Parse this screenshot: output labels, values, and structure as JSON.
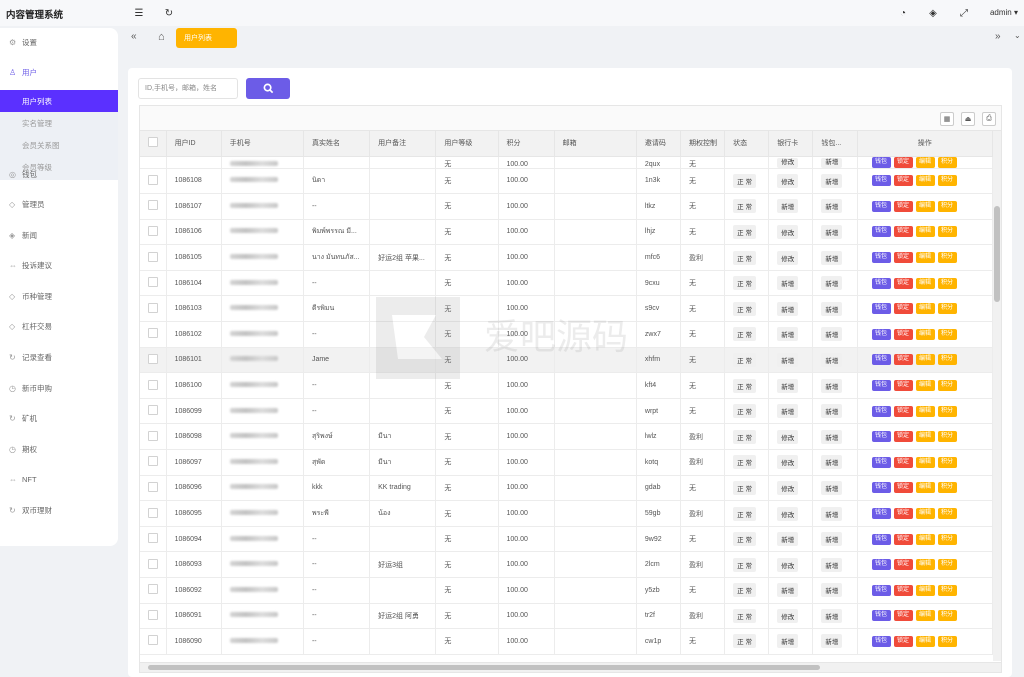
{
  "app": {
    "title": "内容管理系统",
    "user": "admin ▾"
  },
  "sidebar": {
    "items": [
      {
        "label": "设置",
        "icon": "gear-icon",
        "glyph": "⚙"
      },
      {
        "label": "用户",
        "icon": "user-icon",
        "glyph": "♙"
      },
      {
        "label": "钱包",
        "icon": "wallet-icon",
        "glyph": "◎"
      },
      {
        "label": "管理员",
        "icon": "shield-icon",
        "glyph": "◇"
      },
      {
        "label": "新闻",
        "icon": "tag-icon",
        "glyph": "◈"
      },
      {
        "label": "投诉建议",
        "icon": "link-icon",
        "glyph": "⇔"
      },
      {
        "label": "币种管理",
        "icon": "diamond-icon",
        "glyph": "◇"
      },
      {
        "label": "杠杆交易",
        "icon": "diamond-icon",
        "glyph": "◇"
      },
      {
        "label": "记录查看",
        "icon": "refresh-icon",
        "glyph": "↻"
      },
      {
        "label": "新币申购",
        "icon": "clock-icon",
        "glyph": "◷"
      },
      {
        "label": "矿机",
        "icon": "refresh-icon",
        "glyph": "↻"
      },
      {
        "label": "期权",
        "icon": "clock-icon",
        "glyph": "◷"
      },
      {
        "label": "NFT",
        "icon": "link-icon",
        "glyph": "⇔"
      },
      {
        "label": "双币理财",
        "icon": "refresh-icon",
        "glyph": "↻"
      }
    ],
    "submenu": [
      "用户列表",
      "实名管理",
      "会员关系图",
      "会员等级"
    ]
  },
  "tabs": {
    "active": "用户列表"
  },
  "search": {
    "placeholder": "ID,手机号，邮箱，姓名"
  },
  "table": {
    "columns": [
      "用户ID",
      "手机号",
      "真实姓名",
      "用户备注",
      "用户等级",
      "积分",
      "邮箱",
      "邀请码",
      "期权控制",
      "状态",
      "银行卡",
      "钱包...",
      "操作"
    ],
    "actions": [
      "钱包",
      "锁定",
      "编辑",
      "积分"
    ],
    "partial_row": {
      "level": "无",
      "points": "100.00",
      "code": "2qux",
      "ctrl": "无",
      "bank": "修改",
      "wallet": "新增"
    },
    "rows": [
      {
        "id": "1086108",
        "name": "นิดา",
        "note": "",
        "level": "无",
        "points": "100.00",
        "code": "1n3k",
        "ctrl": "无",
        "status": "正 常",
        "bank": "修改",
        "wallet": "新增"
      },
      {
        "id": "1086107",
        "name": "--",
        "note": "",
        "level": "无",
        "points": "100.00",
        "code": "ltkz",
        "ctrl": "无",
        "status": "正 常",
        "bank": "新增",
        "wallet": "新增"
      },
      {
        "id": "1086106",
        "name": "พิมพ์พรรณ มี...",
        "note": "",
        "level": "无",
        "points": "100.00",
        "code": "lhjz",
        "ctrl": "无",
        "status": "正 常",
        "bank": "修改",
        "wallet": "新增"
      },
      {
        "id": "1086105",
        "name": "นาง มันทนภัส...",
        "note": "好运2组 苹果...",
        "level": "无",
        "points": "100.00",
        "code": "mfc6",
        "ctrl": "盈利",
        "status": "正 常",
        "bank": "修改",
        "wallet": "新增"
      },
      {
        "id": "1086104",
        "name": "--",
        "note": "",
        "level": "无",
        "points": "100.00",
        "code": "9cxu",
        "ctrl": "无",
        "status": "正 常",
        "bank": "新增",
        "wallet": "新增"
      },
      {
        "id": "1086103",
        "name": "ดีรพิมน",
        "note": "",
        "level": "无",
        "points": "100.00",
        "code": "s9cv",
        "ctrl": "无",
        "status": "正 常",
        "bank": "新增",
        "wallet": "新增"
      },
      {
        "id": "1086102",
        "name": "--",
        "note": "",
        "level": "无",
        "points": "100.00",
        "code": "zwx7",
        "ctrl": "无",
        "status": "正 常",
        "bank": "新增",
        "wallet": "新增"
      },
      {
        "id": "1086101",
        "name": "Jame",
        "note": "",
        "level": "无",
        "points": "100.00",
        "code": "xhfm",
        "ctrl": "无",
        "status": "正 常",
        "bank": "新增",
        "wallet": "新增"
      },
      {
        "id": "1086100",
        "name": "--",
        "note": "",
        "level": "无",
        "points": "100.00",
        "code": "kft4",
        "ctrl": "无",
        "status": "正 常",
        "bank": "新增",
        "wallet": "新增"
      },
      {
        "id": "1086099",
        "name": "--",
        "note": "",
        "level": "无",
        "points": "100.00",
        "code": "wrpt",
        "ctrl": "无",
        "status": "正 常",
        "bank": "新增",
        "wallet": "新增"
      },
      {
        "id": "1086098",
        "name": "สุริพงษ์",
        "note": "มีนา",
        "level": "无",
        "points": "100.00",
        "code": "lwlz",
        "ctrl": "盈利",
        "status": "正 常",
        "bank": "修改",
        "wallet": "新增"
      },
      {
        "id": "1086097",
        "name": "สุพัด",
        "note": "มีนา",
        "level": "无",
        "points": "100.00",
        "code": "kotq",
        "ctrl": "盈利",
        "status": "正 常",
        "bank": "修改",
        "wallet": "新增"
      },
      {
        "id": "1086096",
        "name": "kkk",
        "note": "KK trading",
        "level": "无",
        "points": "100.00",
        "code": "gdab",
        "ctrl": "无",
        "status": "正 常",
        "bank": "修改",
        "wallet": "新增"
      },
      {
        "id": "1086095",
        "name": "พระพี",
        "note": "น้อง",
        "level": "无",
        "points": "100.00",
        "code": "59gb",
        "ctrl": "盈利",
        "status": "正 常",
        "bank": "修改",
        "wallet": "新增"
      },
      {
        "id": "1086094",
        "name": "--",
        "note": "",
        "level": "无",
        "points": "100.00",
        "code": "9w92",
        "ctrl": "无",
        "status": "正 常",
        "bank": "新增",
        "wallet": "新增"
      },
      {
        "id": "1086093",
        "name": "--",
        "note": "好运3组",
        "level": "无",
        "points": "100.00",
        "code": "2lcm",
        "ctrl": "盈利",
        "status": "正 常",
        "bank": "修改",
        "wallet": "新增"
      },
      {
        "id": "1086092",
        "name": "--",
        "note": "",
        "level": "无",
        "points": "100.00",
        "code": "y5zb",
        "ctrl": "无",
        "status": "正 常",
        "bank": "新增",
        "wallet": "新增"
      },
      {
        "id": "1086091",
        "name": "--",
        "note": "好运2组 阿勇",
        "level": "无",
        "points": "100.00",
        "code": "tr2f",
        "ctrl": "盈利",
        "status": "正 常",
        "bank": "修改",
        "wallet": "新增"
      },
      {
        "id": "1086090",
        "name": "--",
        "note": "",
        "level": "无",
        "points": "100.00",
        "code": "cw1p",
        "ctrl": "无",
        "status": "正 常",
        "bank": "新增",
        "wallet": "新增"
      }
    ]
  },
  "watermark": {
    "text": "爱吧源码"
  },
  "colors": {
    "primary": "#6c5ce7",
    "active_menu": "#5b30ff",
    "tab": "#ffb400",
    "danger": "#f04b3a"
  }
}
